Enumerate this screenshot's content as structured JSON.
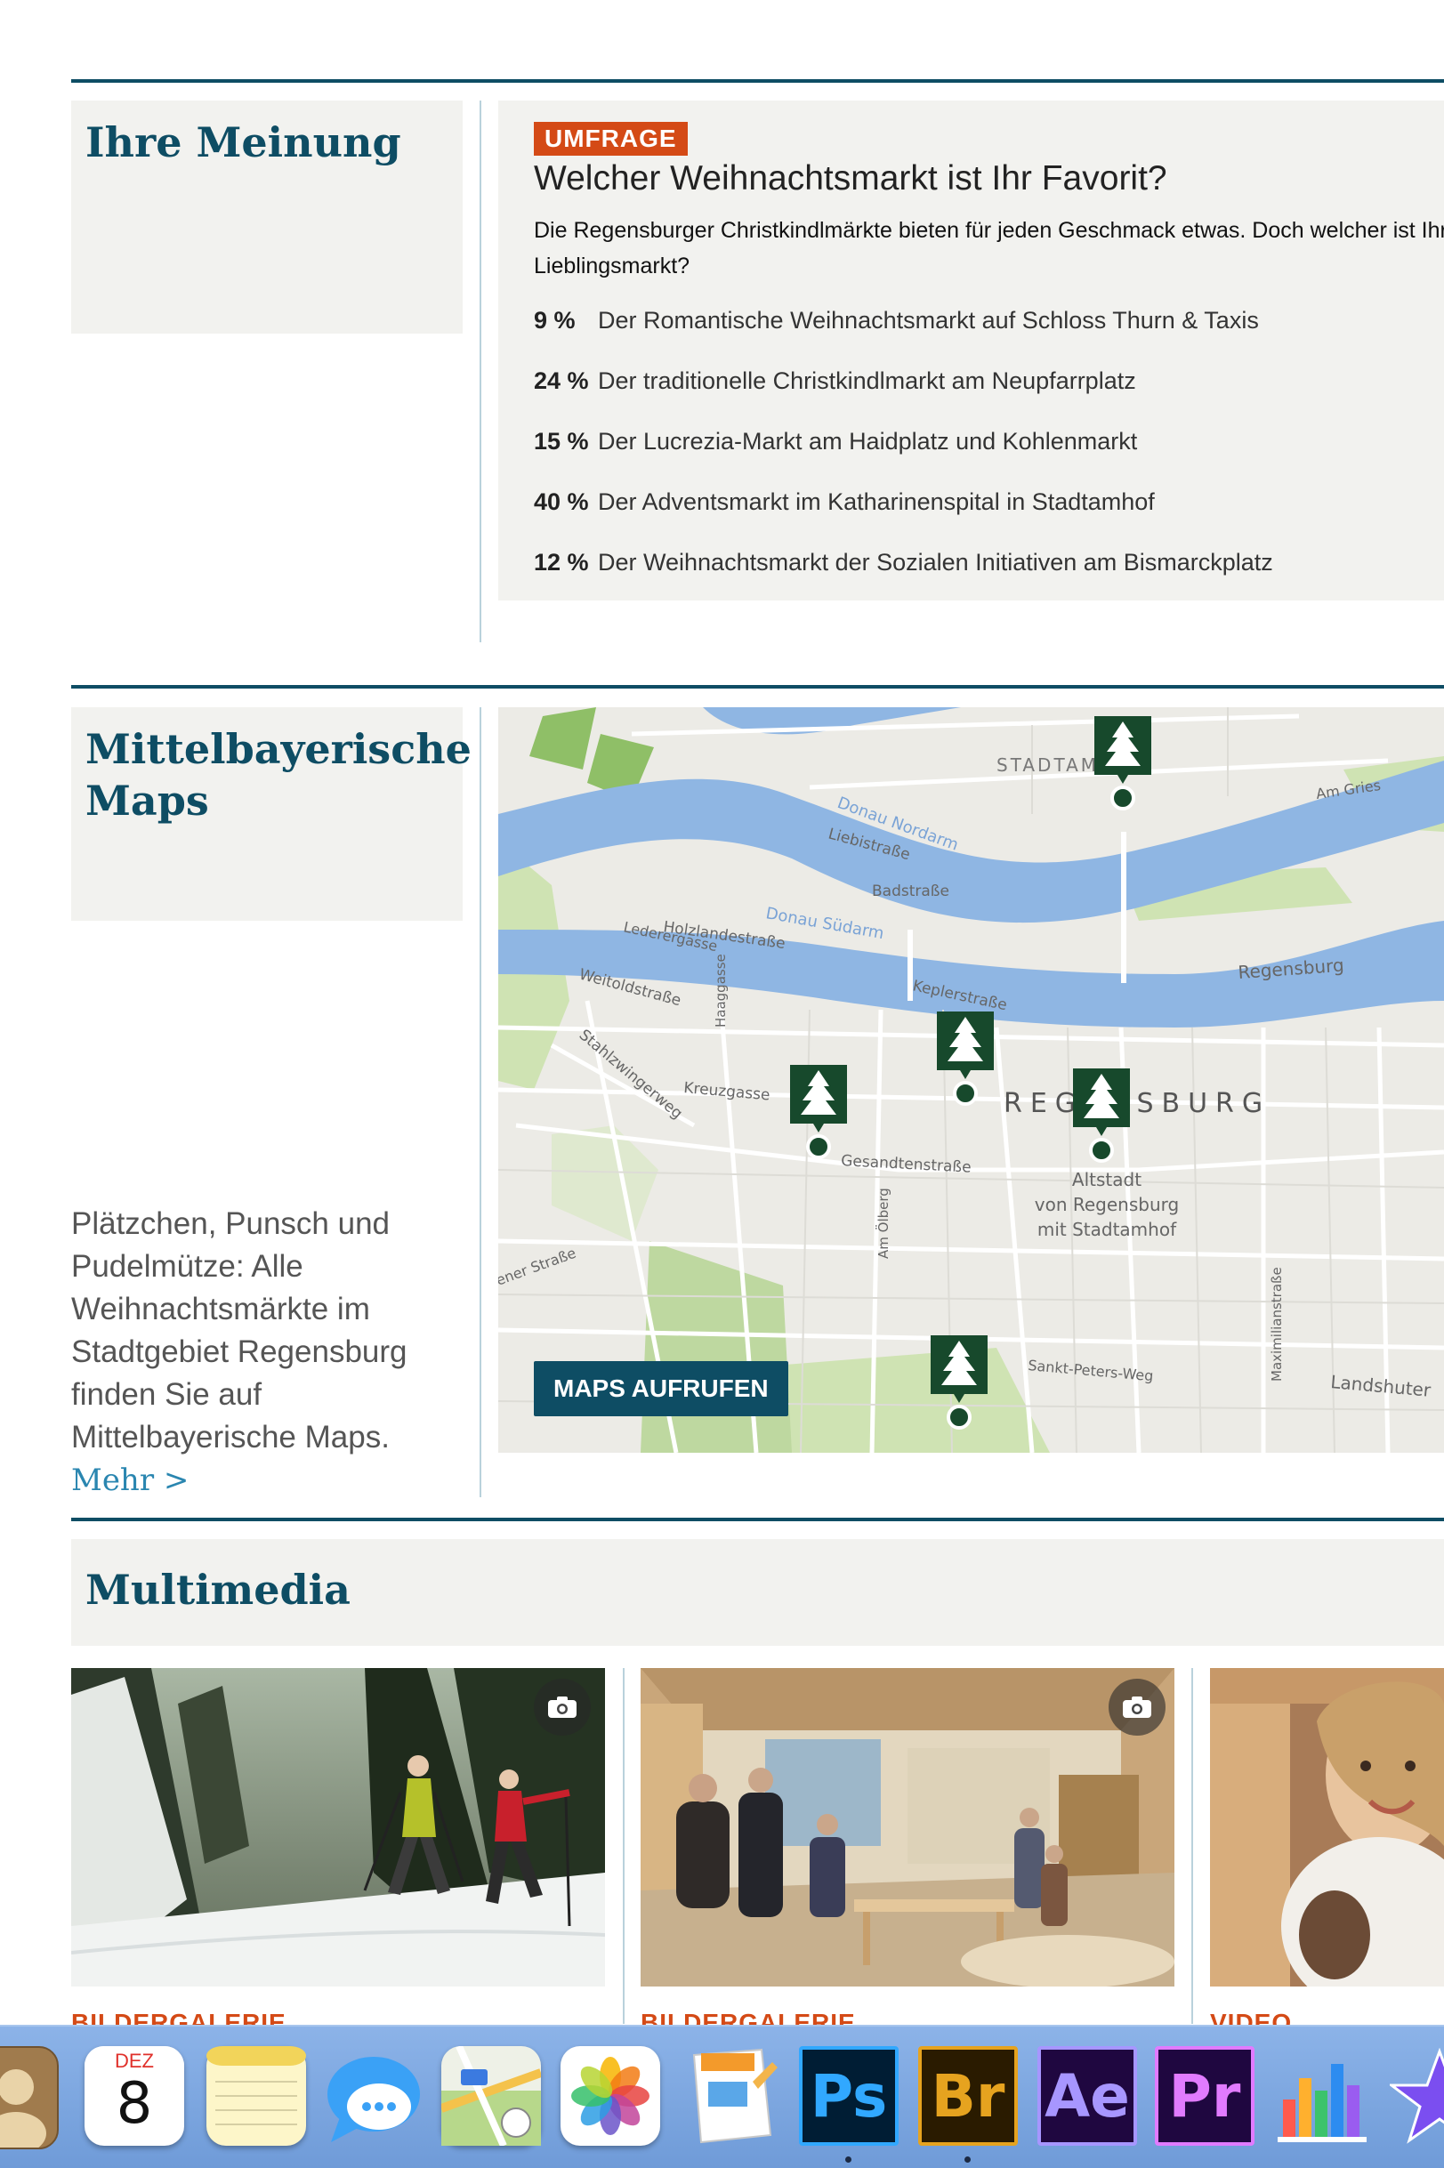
{
  "poll": {
    "section_title": "Ihre Meinung",
    "badge": "UMFRAGE",
    "question": "Welcher Weihnachtsmarkt ist Ihr Favorit?",
    "intro": "Die Regensburger Christkindlmärkte bieten für jeden Geschmack etwas. Doch welcher ist Ihr Lieblingsmarkt?",
    "options": [
      {
        "percent": "9 %",
        "label": "Der Romantische Weihnachtsmarkt auf Schloss Thurn & Taxis"
      },
      {
        "percent": "24 %",
        "label": "Der traditionelle Christkindlmarkt am Neupfarrplatz"
      },
      {
        "percent": "15 %",
        "label": "Der Lucrezia-Markt am Haidplatz und Kohlenmarkt"
      },
      {
        "percent": "40 %",
        "label": "Der Adventsmarkt im Katharinenspital in Stadtamhof"
      },
      {
        "percent": "12 %",
        "label": "Der Weihnachtsmarkt der Sozialen Initiativen am Bismarckplatz"
      }
    ]
  },
  "maps": {
    "section_title_1": "Mittelbayerische",
    "section_title_2": "Maps",
    "description": "Plätzchen, Punsch und Pudelmütze: Alle Weihnachtsmärkte im Stadtgebiet Regensburg finden Sie auf Mittelbayerische Maps.",
    "more_link": "Mehr >",
    "button": "MAPS AUFRUFEN",
    "labels": {
      "stadtamhof": "STADTAMHOF",
      "donau_nordarm": "Donau Nordarm",
      "donau_suedarm": "Donau Südarm",
      "liebistrasse": "Liebistraße",
      "badstrasse": "Badstraße",
      "holzlandestrasse": "Holzlandestraße",
      "lederergasse": "Lederergasse",
      "weitoldstrasse": "Weitoldstraße",
      "haaggasse": "Haaggasse",
      "keplerstrasse": "Keplerstraße",
      "stahlzwingerweg": "Stahlzwingerweg",
      "kreuzgasse": "Kreuzgasse",
      "regensburg_big": "REGENSBURG",
      "regensburg": "Regensburg",
      "am_gries": "Am Gries",
      "gesandtenstrasse": "Gesandtenstraße",
      "altstadt_1": "Altstadt",
      "altstadt_2": "von Regensburg",
      "altstadt_3": "mit Stadtamhof",
      "am_oelberg": "Am Ölberg",
      "maximilianstrasse": "Maximilianstraße",
      "sankt_peters_weg": "Sankt-Peters-Weg",
      "landshuter": "Landshuter",
      "ener_strasse": "ener Straße"
    }
  },
  "multimedia": {
    "section_title": "Multimedia",
    "items": [
      {
        "caption": "BILDERGALERIE"
      },
      {
        "caption": "BILDERGALERIE"
      },
      {
        "caption": "VIDEO"
      }
    ]
  },
  "dock": {
    "calendar_month": "DEZ",
    "calendar_day": "8",
    "apps": [
      {
        "label": "Ps"
      },
      {
        "label": "Br"
      },
      {
        "label": "Ae"
      },
      {
        "label": "Pr"
      }
    ]
  }
}
